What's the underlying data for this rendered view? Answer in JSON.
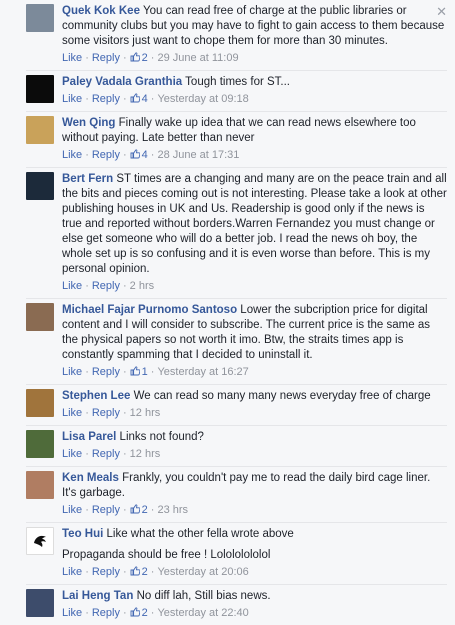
{
  "ui": {
    "like": "Like",
    "reply": "Reply",
    "dot": "·"
  },
  "comments": [
    {
      "name": "Quek Kok Kee",
      "text": "You can read free of charge at the public libraries or community clubs but you may have to fight to gain access to them because some visitors just want to chope them for more than 30 minutes.",
      "likes": "2",
      "time": "29 June at 11:09",
      "avatar_color": "#7c8a9a"
    },
    {
      "name": "Paley Vadala Granthia",
      "text": "Tough times for ST...",
      "likes": "4",
      "time": "Yesterday at 09:18",
      "avatar_color": "#0b0b0b"
    },
    {
      "name": "Wen Qing",
      "text": "Finally wake up idea that we can read news elsewhere too without paying. Late better than never",
      "likes": "4",
      "time": "28 June at 17:31",
      "avatar_color": "#c9a25a"
    },
    {
      "name": "Bert Fern",
      "text": "ST times are a changing and many are on the peace train and all the bits and pieces coming out is not interesting. Please take a look at other publishing houses in UK and Us. Readership is good only if the news is true and reported without borders.Warren Fernandez you must change or else get someone who will do a better job. I read the news oh boy, the whole set up is so confusing and it is even worse than before. This is my personal opinion.",
      "likes": "",
      "time": "2 hrs",
      "avatar_color": "#1c2a3a"
    },
    {
      "name": "Michael Fajar Purnomo Santoso",
      "text": "Lower the subcription price for digital content and I will consider to subscribe. The current price is the same as the physical papers so not worth it imo. Btw, the straits times app is constantly spamming that I decided to uninstall it.",
      "likes": "1",
      "time": "Yesterday at 16:27",
      "avatar_color": "#8a6b52"
    },
    {
      "name": "Stephen Lee",
      "text": "We can read so many many news everyday free of charge",
      "likes": "",
      "time": "12 hrs",
      "avatar_color": "#a0743c"
    },
    {
      "name": "Lisa Parel",
      "text": "Links not found?",
      "likes": "",
      "time": "12 hrs",
      "avatar_color": "#4f6b3a"
    },
    {
      "name": "Ken Meals",
      "text": "Frankly, you couldn't pay me to read the daily bird cage liner. It's garbage.",
      "likes": "2",
      "time": "23 hrs",
      "avatar_color": "#b07d62"
    },
    {
      "name": "Teo Hui",
      "text": "Like what the other fella wrote above",
      "likes": "",
      "time": "",
      "avatar_color": "#ffffff",
      "sub_text": "Propaganda should be free ! Lolololololol",
      "sub_likes": "2",
      "sub_time": "Yesterday at 20:06"
    },
    {
      "name": "Lai Heng Tan",
      "text": "No diff lah, Still bias news.",
      "likes": "2",
      "time": "Yesterday at 22:40",
      "avatar_color": "#3d4c6b"
    }
  ]
}
